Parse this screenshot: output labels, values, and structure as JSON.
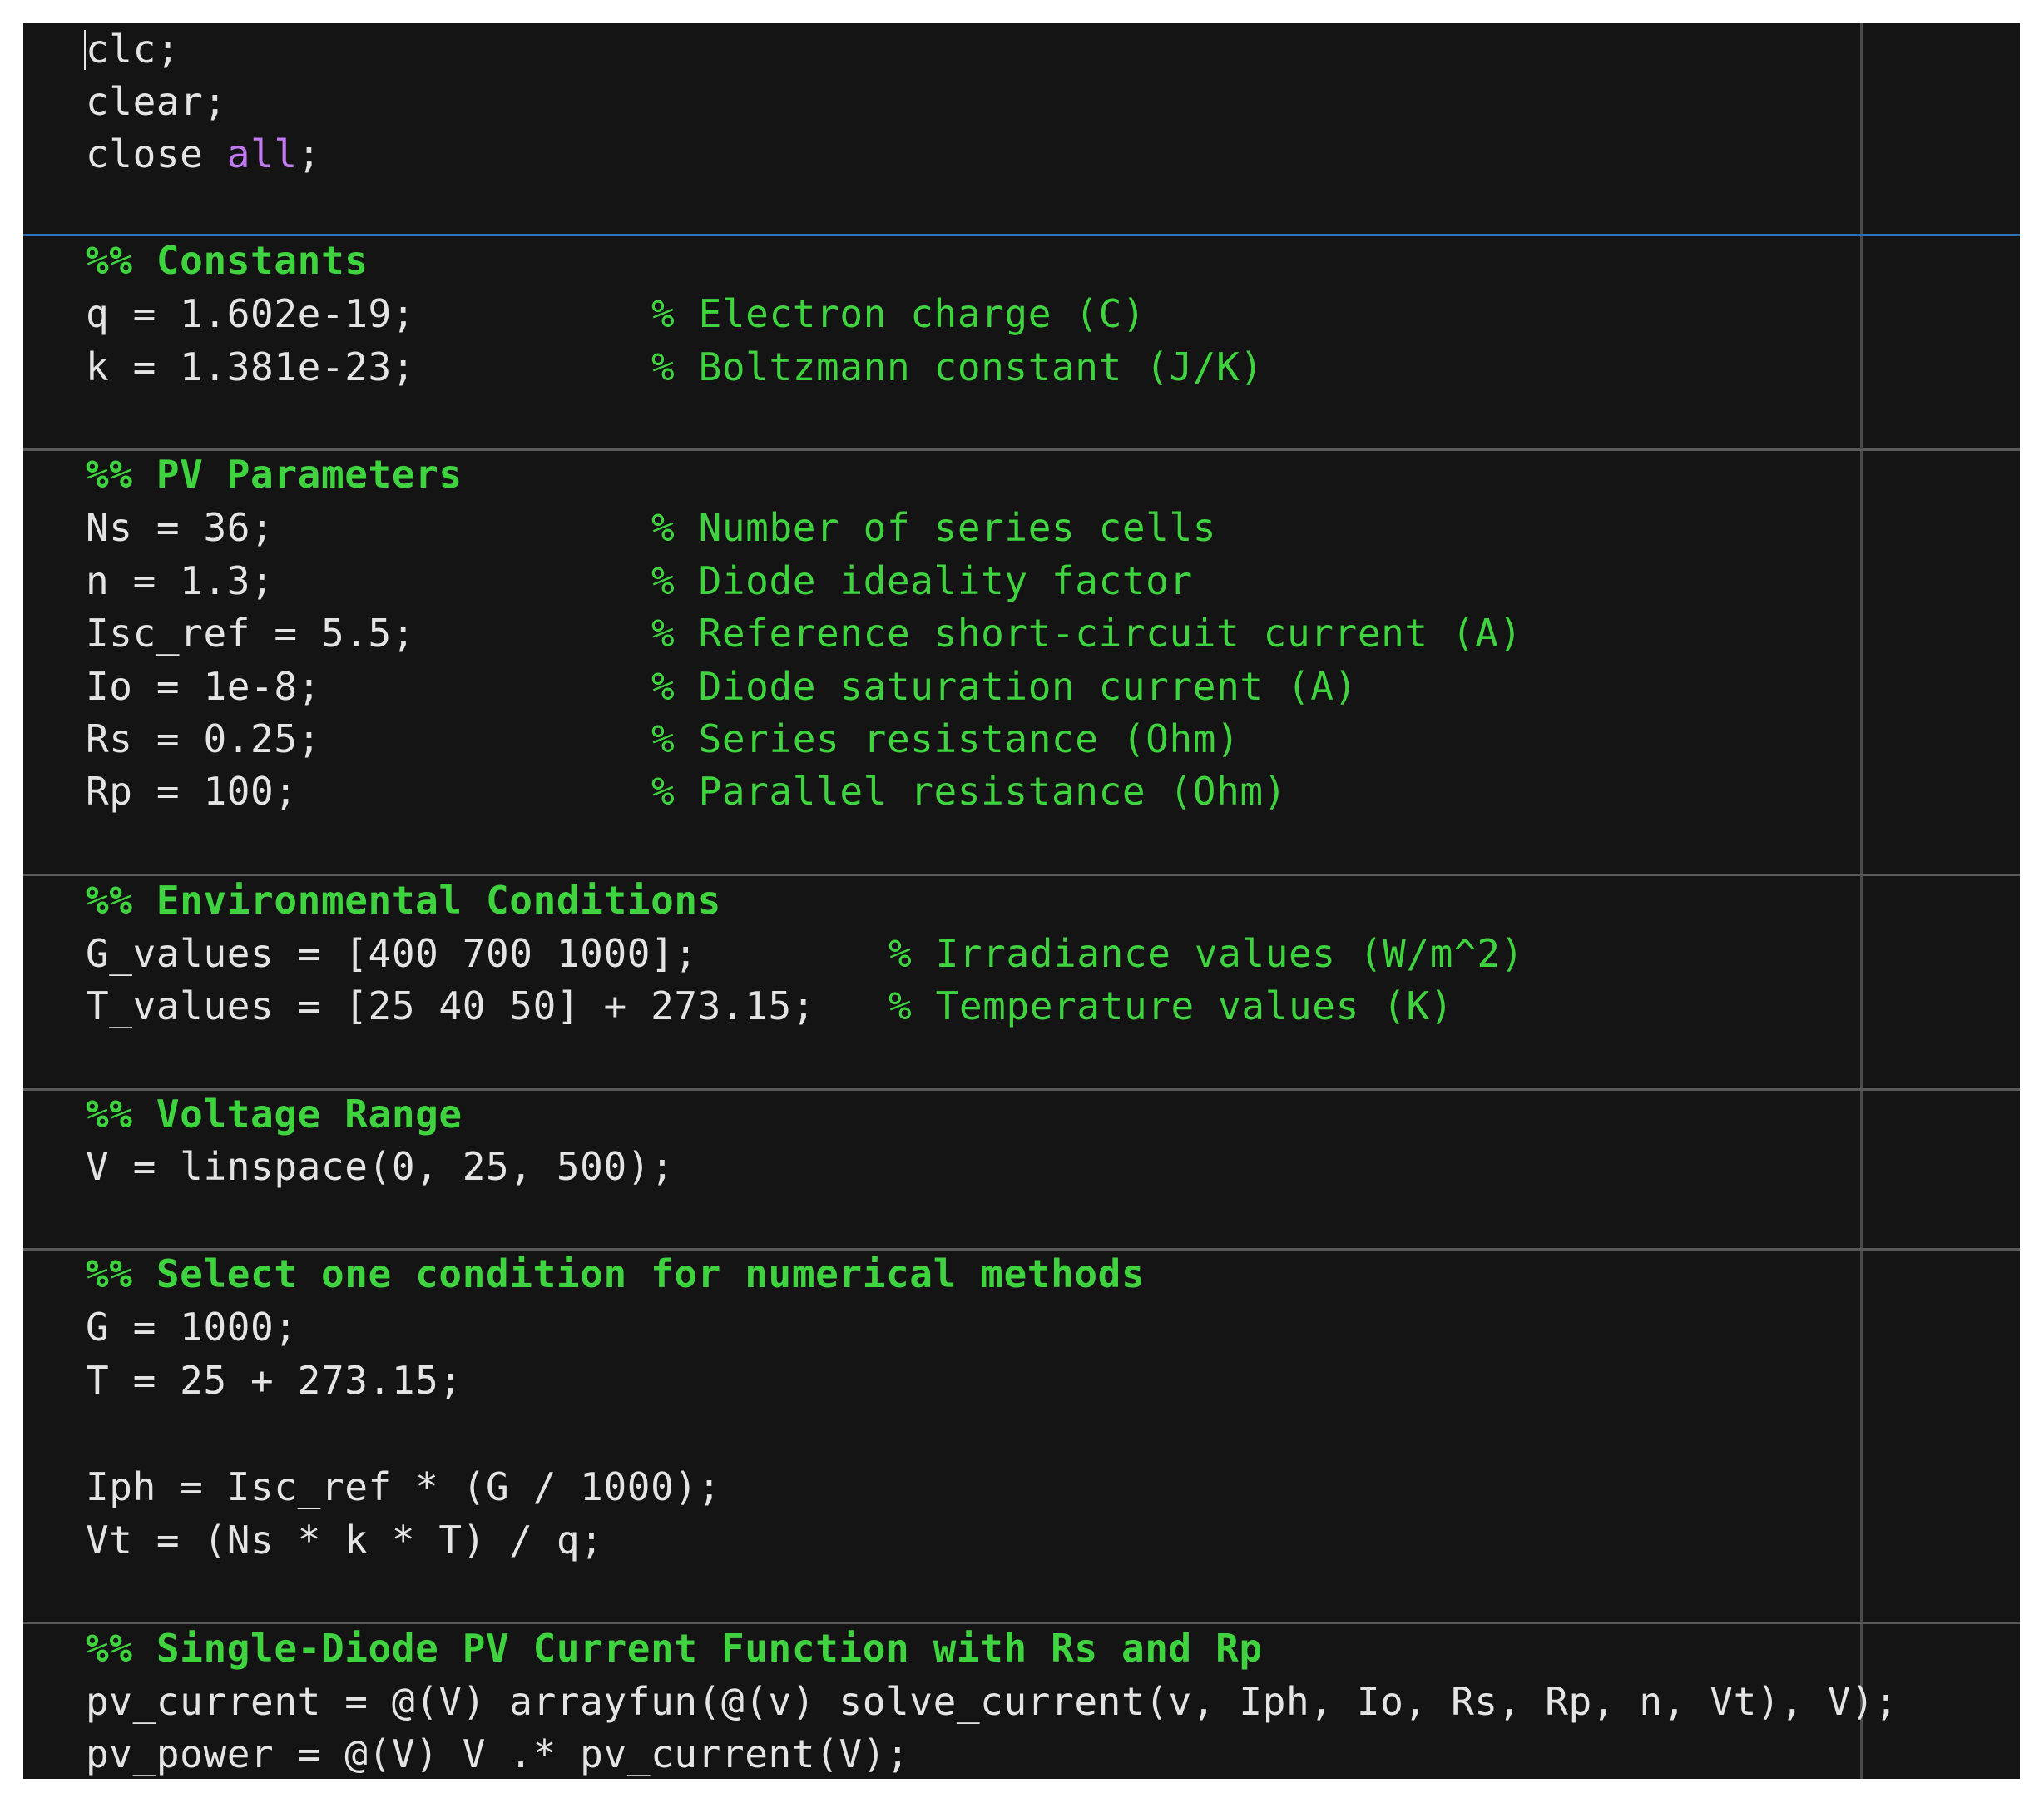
{
  "code": {
    "l1": "clc;",
    "l2": "clear;",
    "l3_pre": "close ",
    "l3_kw": "all",
    "l3_post": ";",
    "sec_constants": "%% Constants",
    "q_code": "q = 1.602e-19;",
    "q_cmt": "% Electron charge (C)",
    "k_code": "k = 1.381e-23;",
    "k_cmt": "% Boltzmann constant (J/K)",
    "sec_pv": "%% PV Parameters",
    "ns_code": "Ns = 36;",
    "ns_cmt": "% Number of series cells",
    "n_code": "n = 1.3;",
    "n_cmt": "% Diode ideality factor",
    "isc_code": "Isc_ref = 5.5;",
    "isc_cmt": "% Reference short-circuit current (A)",
    "io_code": "Io = 1e-8;",
    "io_cmt": "% Diode saturation current (A)",
    "rs_code": "Rs = 0.25;",
    "rs_cmt": "% Series resistance (Ohm)",
    "rp_code": "Rp = 100;",
    "rp_cmt": "% Parallel resistance (Ohm)",
    "sec_env": "%% Environmental Conditions",
    "g_values_code": "G_values = [400 700 1000];",
    "g_values_cmt": "% Irradiance values (W/m^2)",
    "t_values_code": "T_values = [25 40 50] + 273.15;",
    "t_values_cmt": "% Temperature values (K)",
    "sec_voltage": "%% Voltage Range",
    "v_code": "V = linspace(0, 25, 500);",
    "sec_select": "%% Select one condition for numerical methods",
    "g_code": "G = 1000;",
    "t_code": "T = 25 + 273.15;",
    "iph_code": "Iph = Isc_ref * (G / 1000);",
    "vt_code": "Vt = (Ns * k * T) / q;",
    "sec_single": "%% Single-Diode PV Current Function with Rs and Rp",
    "pv_current_code": "pv_current = @(V) arrayfun(@(v) solve_current(v, Iph, Io, Rs, Rp, n, Vt), V);",
    "pv_power_code": "pv_power = @(V) V .* pv_current(V);"
  },
  "colors": {
    "background": "#141414",
    "text": "#e4e4e4",
    "comment": "#3fd43f",
    "keyword": "#c27af2",
    "section_divider": "#5a5a5a",
    "active_section_divider": "#2f6fb5"
  }
}
